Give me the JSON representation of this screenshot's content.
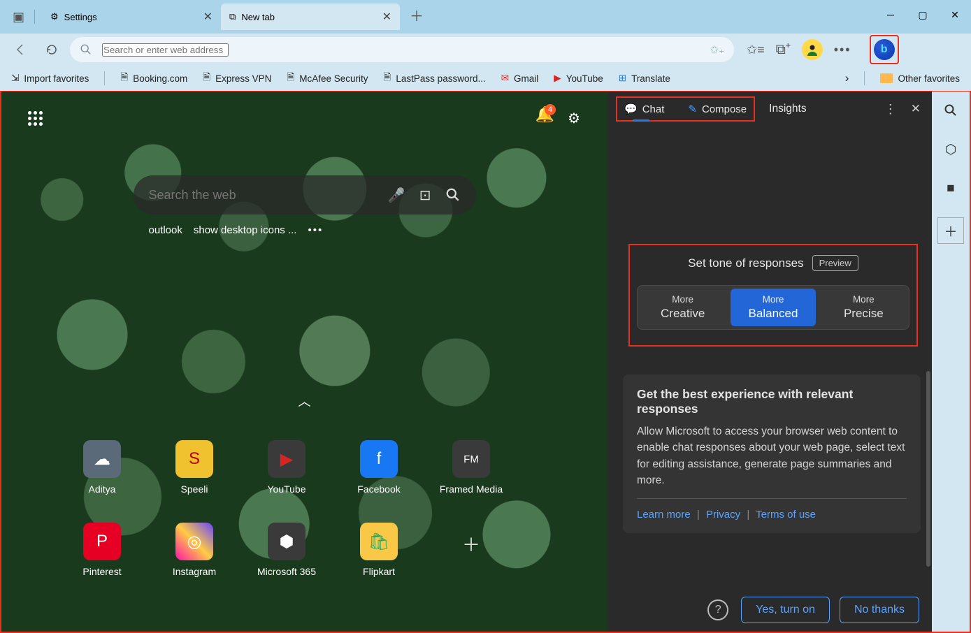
{
  "tabs": [
    {
      "label": "Settings",
      "icon": "gear-icon",
      "active": false
    },
    {
      "label": "New tab",
      "icon": "newtab-icon",
      "active": true
    }
  ],
  "addressbar": {
    "placeholder": "Search or enter web address"
  },
  "bookmarks": {
    "import_label": "Import favorites",
    "items": [
      "Booking.com",
      "Express VPN",
      "McAfee Security",
      "LastPass password...",
      "Gmail",
      "YouTube",
      "Translate"
    ],
    "other_label": "Other favorites"
  },
  "ntp": {
    "search_placeholder": "Search the web",
    "notification_count": "4",
    "suggestions": [
      "outlook",
      "show desktop icons ..."
    ],
    "tiles_row1": [
      {
        "label": "Aditya",
        "bg": "#5a6a78",
        "glyph": "☁"
      },
      {
        "label": "Speeli",
        "bg": "#f0c230",
        "glyph": "S"
      },
      {
        "label": "YouTube",
        "bg": "#d92424",
        "glyph": "▶"
      },
      {
        "label": "Facebook",
        "bg": "#1877f2",
        "glyph": "f"
      },
      {
        "label": "Framed Media",
        "bg": "#3a3a3a",
        "glyph": "F͋ᴍ"
      }
    ],
    "tiles_row2": [
      {
        "label": "Pinterest",
        "bg": "#e60023",
        "glyph": "P"
      },
      {
        "label": "Instagram",
        "bg": "#d63384",
        "glyph": "◎"
      },
      {
        "label": "Microsoft 365",
        "bg": "#3a3a3a",
        "glyph": "⬢"
      },
      {
        "label": "Flipkart",
        "bg": "#f0c230",
        "glyph": "🛒"
      }
    ]
  },
  "sidepanel": {
    "tabs": {
      "chat": "Chat",
      "compose": "Compose",
      "insights": "Insights"
    },
    "tone": {
      "title": "Set tone of responses",
      "preview": "Preview",
      "opts": [
        {
          "l1": "More",
          "l2": "Creative"
        },
        {
          "l1": "More",
          "l2": "Balanced"
        },
        {
          "l1": "More",
          "l2": "Precise"
        }
      ]
    },
    "promo": {
      "title": "Get the best experience with relevant responses",
      "body": "Allow Microsoft to access your browser web content to enable chat responses about your web page, select text for editing assistance, generate page summaries and more.",
      "links": {
        "learn": "Learn more",
        "privacy": "Privacy",
        "terms": "Terms of use"
      }
    },
    "buttons": {
      "yes": "Yes, turn on",
      "no": "No thanks"
    }
  }
}
